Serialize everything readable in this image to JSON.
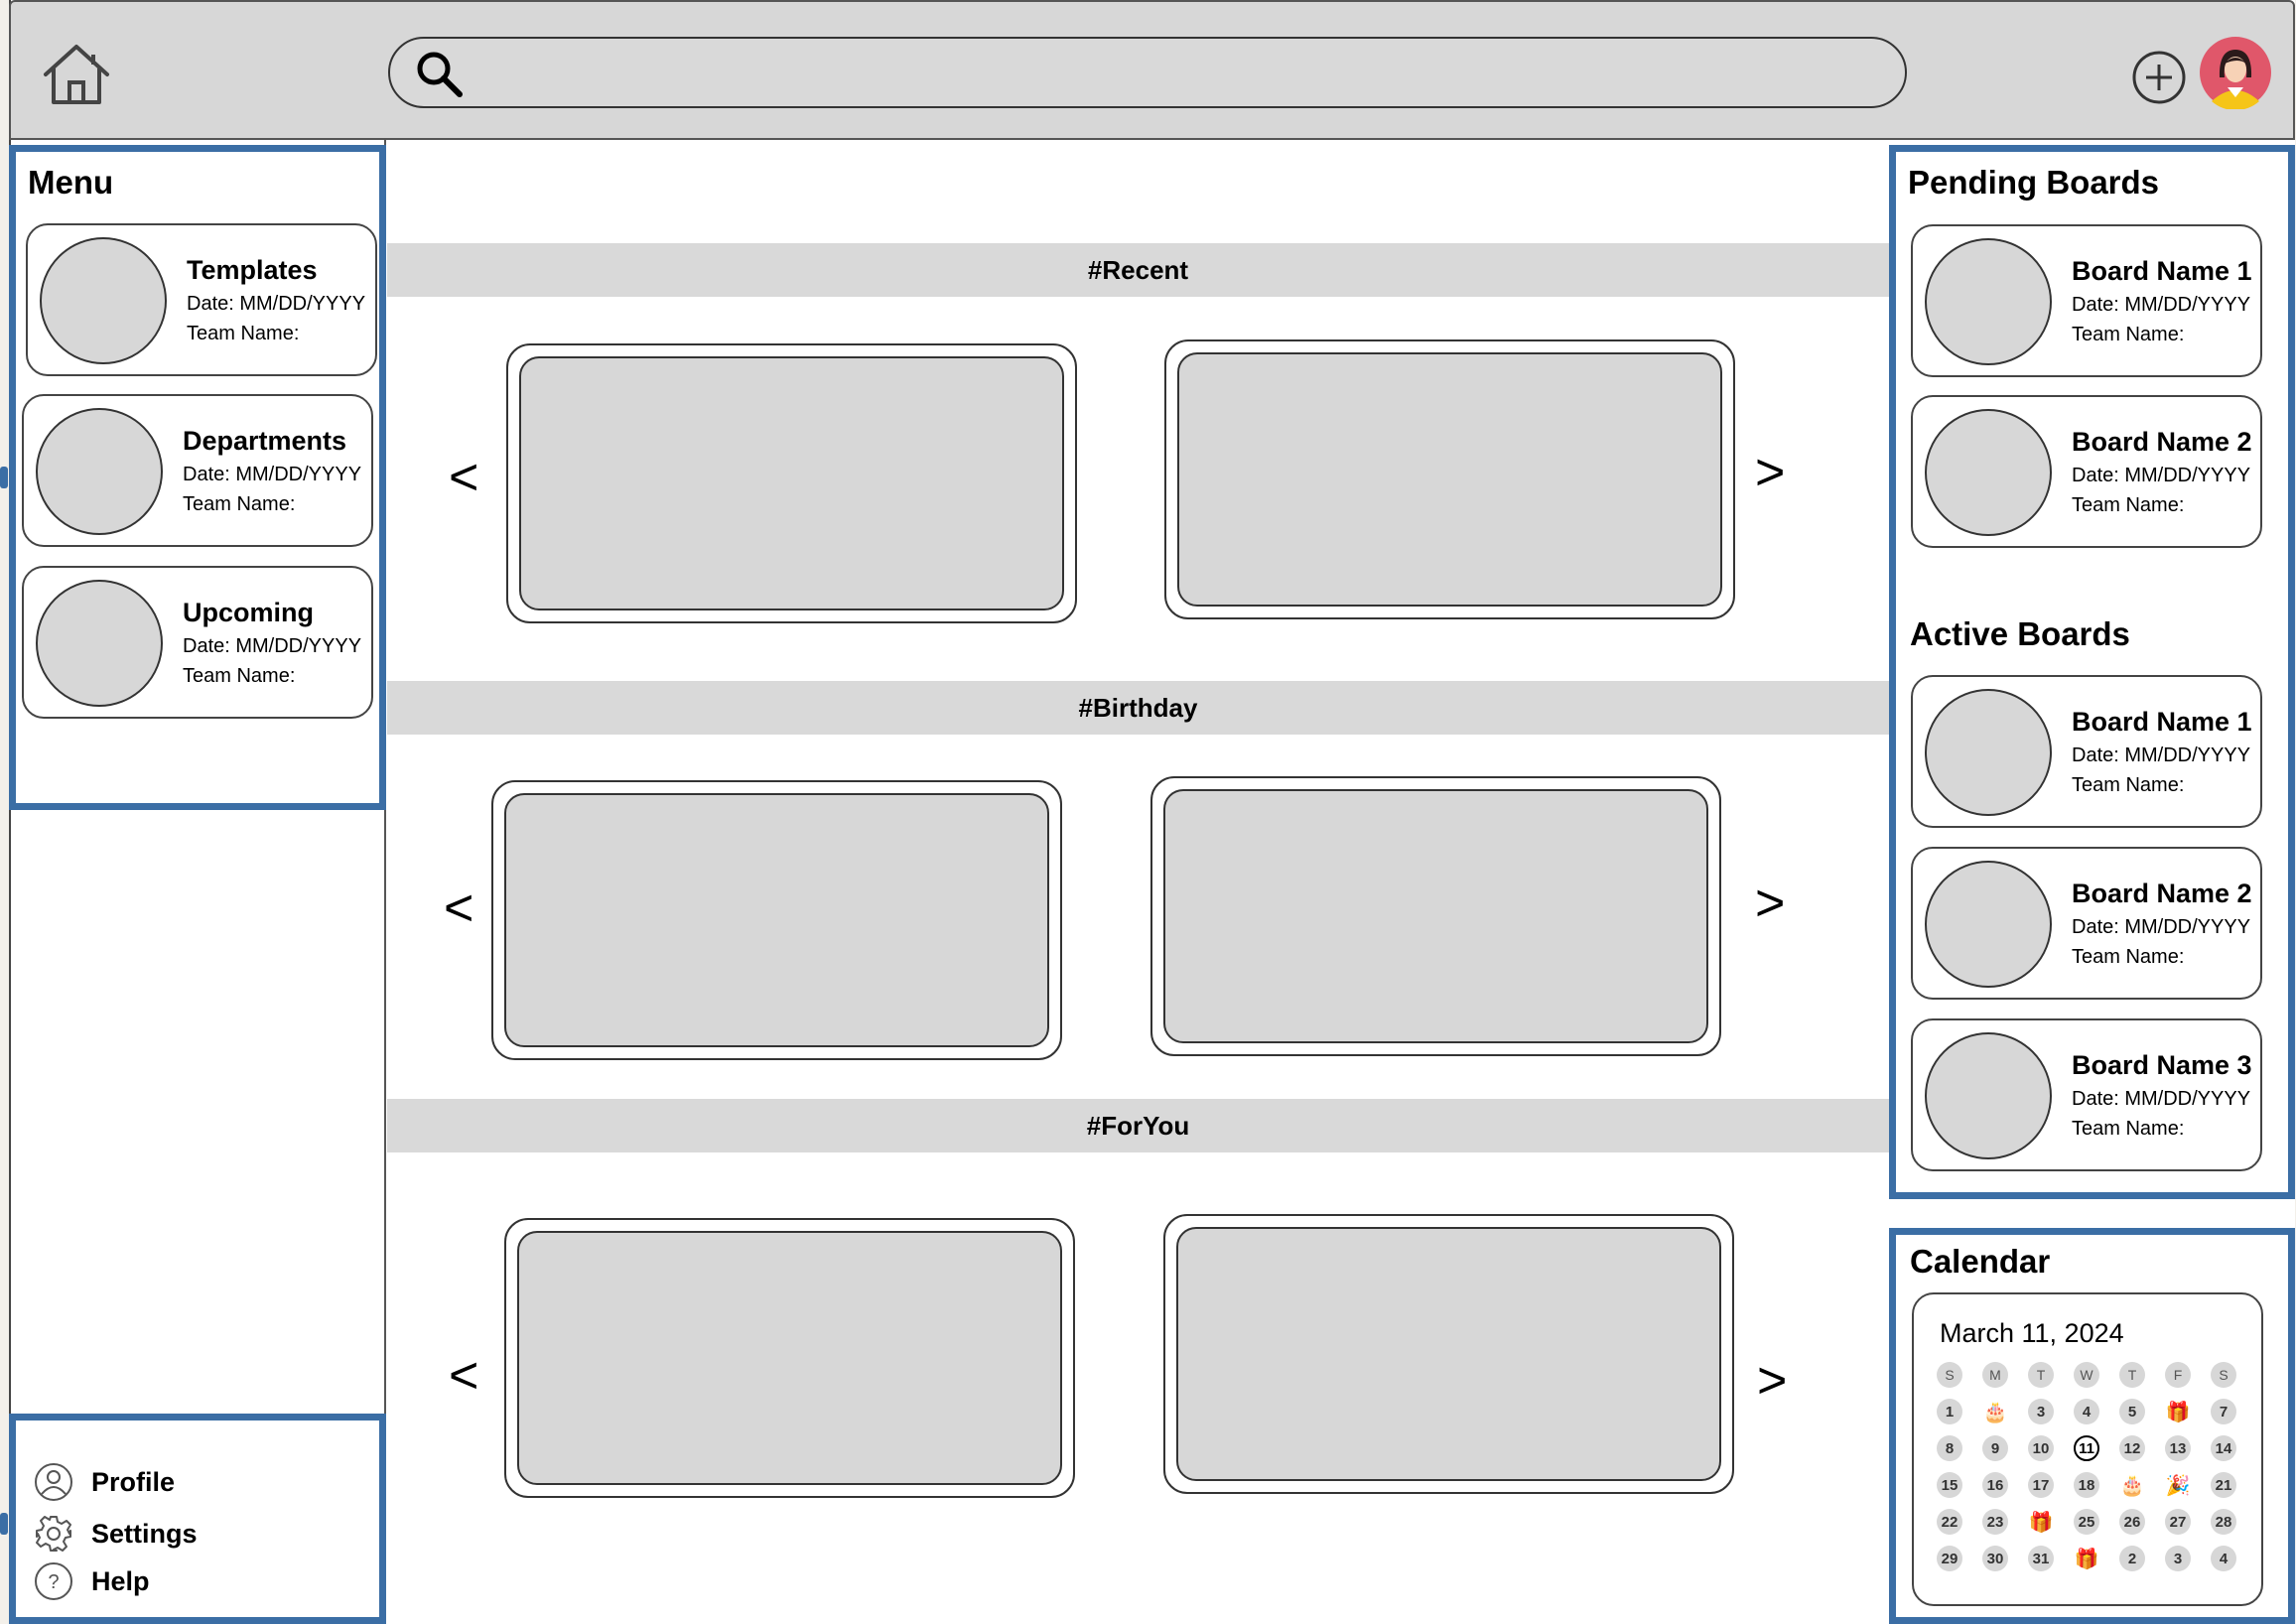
{
  "search": {
    "placeholder": "",
    "value": ""
  },
  "menu": {
    "title": "Menu",
    "items": [
      {
        "title": "Templates",
        "date": "Date: MM/DD/YYYY",
        "team": "Team Name:"
      },
      {
        "title": "Departments",
        "date": "Date: MM/DD/YYYY",
        "team": "Team Name:"
      },
      {
        "title": "Upcoming",
        "date": "Date: MM/DD/YYYY",
        "team": "Team Name:"
      }
    ]
  },
  "bottom_menu": {
    "profile": "Profile",
    "settings": "Settings",
    "help": "Help"
  },
  "sections": [
    {
      "label": "#Recent"
    },
    {
      "label": "#Birthday"
    },
    {
      "label": "#ForYou"
    }
  ],
  "arrows": {
    "prev": "<",
    "next": ">"
  },
  "pending": {
    "title": "Pending Boards",
    "items": [
      {
        "title": "Board Name 1",
        "date": "Date: MM/DD/YYYY",
        "team": "Team Name:"
      },
      {
        "title": "Board Name 2",
        "date": "Date: MM/DD/YYYY",
        "team": "Team Name:"
      }
    ]
  },
  "active": {
    "title": "Active Boards",
    "items": [
      {
        "title": "Board Name 1",
        "date": "Date: MM/DD/YYYY",
        "team": "Team Name:"
      },
      {
        "title": "Board Name 2",
        "date": "Date: MM/DD/YYYY",
        "team": "Team Name:"
      },
      {
        "title": "Board Name 3",
        "date": "Date: MM/DD/YYYY",
        "team": "Team Name:"
      }
    ]
  },
  "calendar": {
    "title": "Calendar",
    "date": "March 11, 2024",
    "weekdays": [
      "S",
      "M",
      "T",
      "W",
      "T",
      "F",
      "S"
    ],
    "days": [
      "1",
      "cake-icon",
      "3",
      "4",
      "5",
      "gift-icon",
      "7",
      "8",
      "9",
      "10",
      "11",
      "12",
      "13",
      "14",
      "15",
      "16",
      "17",
      "18",
      "cake-icon",
      "party-popper-icon",
      "21",
      "22",
      "23",
      "gift-icon",
      "25",
      "26",
      "27",
      "28",
      "29",
      "30",
      "31",
      "gift-icon",
      "2",
      "3",
      "4"
    ],
    "today": "11"
  },
  "colors": {
    "panel_border": "#3b6ea5",
    "topbar": "#d7d7d7",
    "placeholder_fill": "#d7d7d7"
  }
}
